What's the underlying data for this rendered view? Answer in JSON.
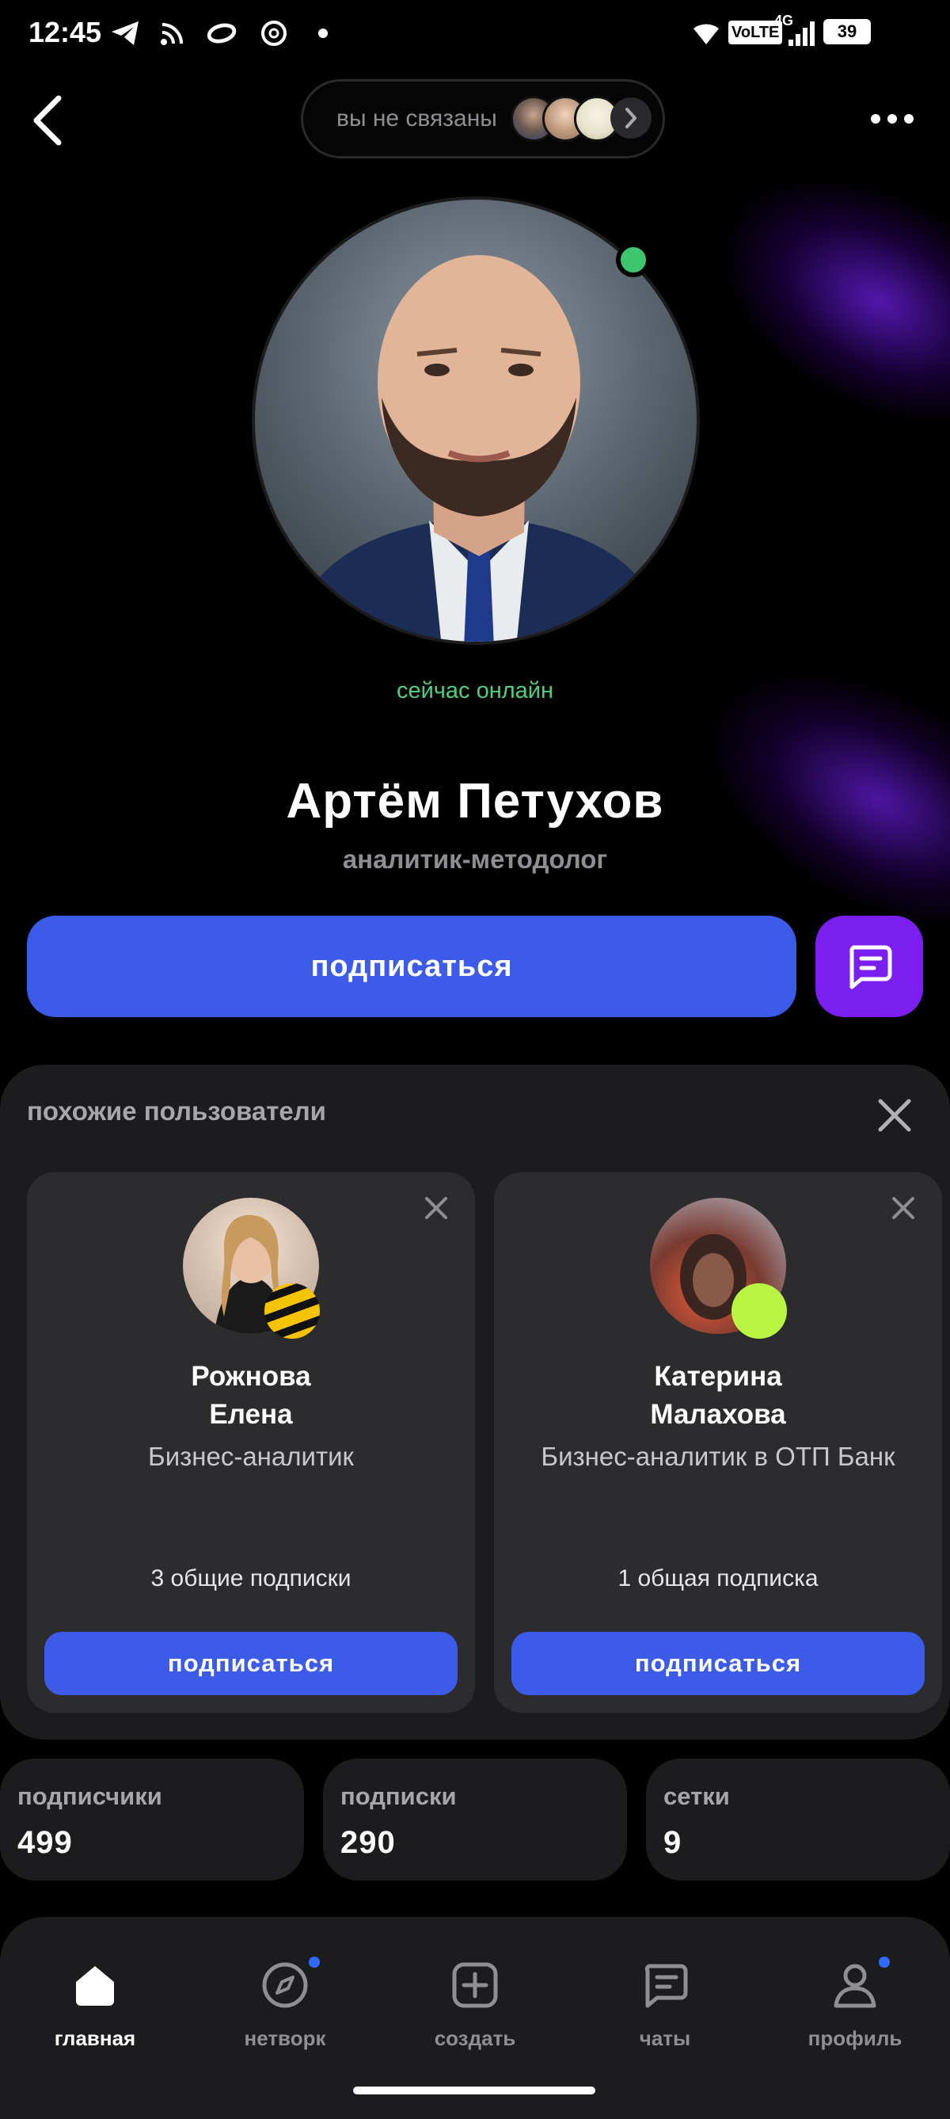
{
  "status_bar": {
    "time": "12:45",
    "network_label": "VoLTE",
    "network_type": "4G",
    "battery": "39"
  },
  "header": {
    "connection_text": "вы не связаны",
    "icons": [
      "back-arrow-icon",
      "more-dots-icon",
      "chevron-right-icon"
    ]
  },
  "profile": {
    "online_status": "сейчас онлайн",
    "name": "Артём Петухов",
    "role": "аналитик-методолог",
    "subscribe_label": "подписаться",
    "colors": {
      "primary": "#3b5be8",
      "chat": "#7b1ff0",
      "online": "#3ec66f"
    }
  },
  "similar_users": {
    "title": "похожие пользователи",
    "cards": [
      {
        "name_line1": "Рожнова",
        "name_line2": "Елена",
        "role": "Бизнес-аналитик",
        "mutual": "3 общие подписки",
        "button": "подписаться"
      },
      {
        "name_line1": "Катерина",
        "name_line2": "Малахова",
        "role": "Бизнес-аналитик в ОТП Банк",
        "mutual": "1 общая подписка",
        "button": "подписаться"
      }
    ]
  },
  "stats": [
    {
      "label": "подписчики",
      "value": "499"
    },
    {
      "label": "подписки",
      "value": "290"
    },
    {
      "label": "сетки",
      "value": "9"
    }
  ],
  "bottom_nav": [
    {
      "label": "главная",
      "icon": "home-icon",
      "active": true
    },
    {
      "label": "нетворк",
      "icon": "compass-icon",
      "badge": true
    },
    {
      "label": "создать",
      "icon": "plus-square-icon"
    },
    {
      "label": "чаты",
      "icon": "chat-icon"
    },
    {
      "label": "профиль",
      "icon": "user-icon",
      "badge": true
    }
  ]
}
